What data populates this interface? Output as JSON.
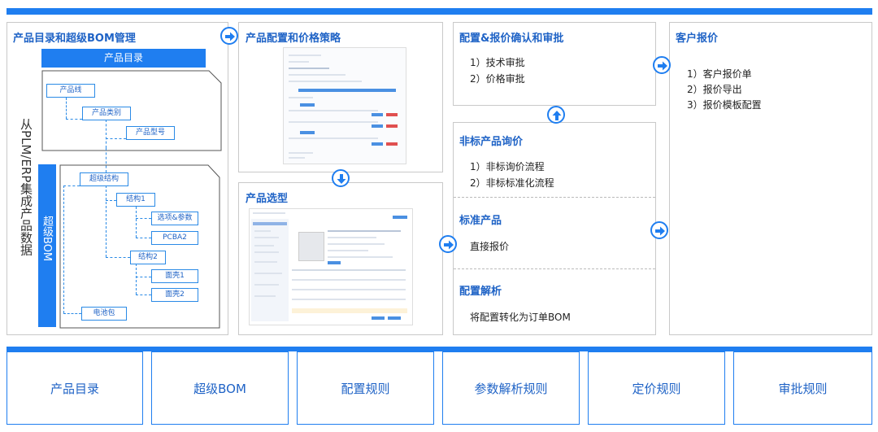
{
  "sections": {
    "catalog": {
      "title": "产品目录和超级BOM管理",
      "header_label": "产品目录",
      "side_text": "从PLM/ERP集成产品数据",
      "super_bom_label": "超级BOM",
      "tree_top": [
        "产品线",
        "产品类别",
        "产品型号"
      ],
      "tree_bom": [
        "超级结构",
        "结构1",
        "选项&参数",
        "PCBA2",
        "结构2",
        "面壳1",
        "面壳2",
        "电池包"
      ]
    },
    "config": {
      "title": "产品配置和价格策略"
    },
    "selection": {
      "title": "产品选型"
    },
    "confirm": {
      "title": "配置&报价确认和审批",
      "items": [
        "1）技术审批",
        "2）价格审批"
      ]
    },
    "nonstandard": {
      "title": "非标产品询价",
      "items": [
        "1）非标询价流程",
        "2）非标标准化流程"
      ]
    },
    "standard": {
      "title": "标准产品",
      "items": [
        "直接报价"
      ]
    },
    "parse": {
      "title": "配置解析",
      "items": [
        "将配置转化为订单BOM"
      ]
    },
    "quote": {
      "title": "客户报价",
      "items": [
        "1）客户报价单",
        "2）报价导出",
        "3）报价模板配置"
      ]
    }
  },
  "bottom_labels": [
    "产品目录",
    "超级BOM",
    "配置规则",
    "参数解析规则",
    "定价规则",
    "审批规则"
  ],
  "icons": {
    "arrow": "arrow-circle-icon"
  },
  "colors": {
    "accent": "#1f7ef0",
    "title": "#1f63c6"
  }
}
